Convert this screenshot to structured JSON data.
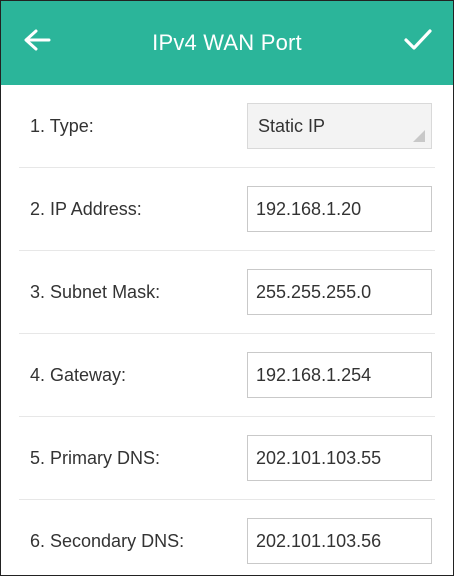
{
  "header": {
    "title": "IPv4 WAN Port",
    "background_color": "#2bb59a",
    "back_icon": "arrow-left-icon",
    "confirm_icon": "checkmark-icon"
  },
  "form": {
    "type": {
      "label": "1. Type:",
      "value": "Static IP"
    },
    "ip_address": {
      "label": "2. IP Address:",
      "value": "192.168.1.20"
    },
    "subnet_mask": {
      "label": "3. Subnet Mask:",
      "value": "255.255.255.0"
    },
    "gateway": {
      "label": "4. Gateway:",
      "value": "192.168.1.254"
    },
    "primary_dns": {
      "label": "5. Primary DNS:",
      "value": "202.101.103.55"
    },
    "secondary_dns": {
      "label": "6. Secondary DNS:",
      "value": "202.101.103.56"
    }
  }
}
